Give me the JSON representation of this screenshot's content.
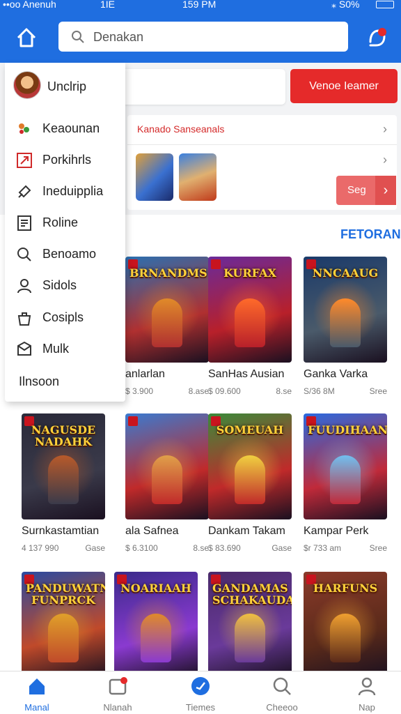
{
  "status_bar": {
    "left": "••oo Anenuh",
    "mid": "1IE",
    "time": "159 PM",
    "battery": "S0%"
  },
  "header": {
    "search_placeholder": "Denakan"
  },
  "action_button": "Venoe Ieamer",
  "promo": {
    "title": "Kanado Sanseanals",
    "button": "Seg"
  },
  "section_link": "FETORAN",
  "drawer": {
    "profile_name": "Unclrip",
    "items": [
      {
        "label": "Keaounan",
        "icon": "flower-icon"
      },
      {
        "label": "Porkihrls",
        "icon": "tag-icon"
      },
      {
        "label": "Ineduipplia",
        "icon": "rocket-icon"
      },
      {
        "label": "Roline",
        "icon": "list-icon"
      },
      {
        "label": "Benoamo",
        "icon": "search-icon"
      },
      {
        "label": "Sidols",
        "icon": "user-icon"
      },
      {
        "label": "Cosipls",
        "icon": "bag-icon"
      },
      {
        "label": "Mulk",
        "icon": "mail-icon"
      }
    ],
    "footer": "Ilnsoon"
  },
  "games": [
    {
      "title": "anlarlan",
      "price": "$ 3.900",
      "tag": "8.ase",
      "cover_text": "BRNANDMS",
      "colors": [
        "#2a6fb0",
        "#e08a2a",
        "#b03030"
      ]
    },
    {
      "title": "SanHas Ausian",
      "price": "$ 09.600",
      "tag": "8.se",
      "cover_text": "KURFAX",
      "colors": [
        "#6a2a9a",
        "#ff6a2a",
        "#b8202a"
      ]
    },
    {
      "title": "Ganka Varka",
      "price": "S/36 8M",
      "tag": "Sree",
      "cover_text": "NNCAAUG",
      "colors": [
        "#1a3a6a",
        "#ff8a2a",
        "#4a5a6a"
      ]
    },
    {
      "title": "Surnkastamtian",
      "price": "4 137 990",
      "tag": "Gase",
      "cover_text": "NAGUSDE NADAHK",
      "colors": [
        "#2a2a3a",
        "#b85a2a",
        "#3a3a4a"
      ]
    },
    {
      "title": "ala Safnea",
      "price": "$ 6.3100",
      "tag": "8.se",
      "cover_text": "",
      "colors": [
        "#3a7ad0",
        "#e0a04a",
        "#c02a2a"
      ]
    },
    {
      "title": "Dankam Takam",
      "price": "$ 83.690",
      "tag": "Gase",
      "cover_text": "SOMEUAH",
      "colors": [
        "#3a8a3a",
        "#f0d040",
        "#c02a2a"
      ]
    },
    {
      "title": "Kampar Perk",
      "price": "$r 733 am",
      "tag": "Sree",
      "cover_text": "FUUDIHAAN",
      "colors": [
        "#2a6ae0",
        "#70c0f0",
        "#c02a3a"
      ]
    },
    {
      "title": "",
      "price": "",
      "tag": "",
      "cover_text": "PANDUWATNK FUNPRCK",
      "colors": [
        "#2a4aa0",
        "#e0a02a",
        "#c04a2a"
      ]
    },
    {
      "title": "",
      "price": "",
      "tag": "",
      "cover_text": "NOARIAAH",
      "colors": [
        "#3a2a8a",
        "#e08a2a",
        "#8a3ad0"
      ]
    },
    {
      "title": "",
      "price": "",
      "tag": "",
      "cover_text": "GANDAMAS SCHAKAUDA",
      "colors": [
        "#4a2a6a",
        "#f0c040",
        "#6a3a9a"
      ]
    },
    {
      "title": "",
      "price": "",
      "tag": "",
      "cover_text": "HARFUNS",
      "colors": [
        "#8a3a2a",
        "#f0a030",
        "#5a2a1a"
      ]
    }
  ],
  "bottom_nav": [
    {
      "label": "Manal",
      "icon": "home-icon",
      "active": true
    },
    {
      "label": "Nlanah",
      "icon": "store-icon",
      "active": false
    },
    {
      "label": "Tiemes",
      "icon": "games-icon",
      "active": false
    },
    {
      "label": "Cheeoo",
      "icon": "search-icon",
      "active": false
    },
    {
      "label": "Nap",
      "icon": "profile-icon",
      "active": false
    }
  ]
}
